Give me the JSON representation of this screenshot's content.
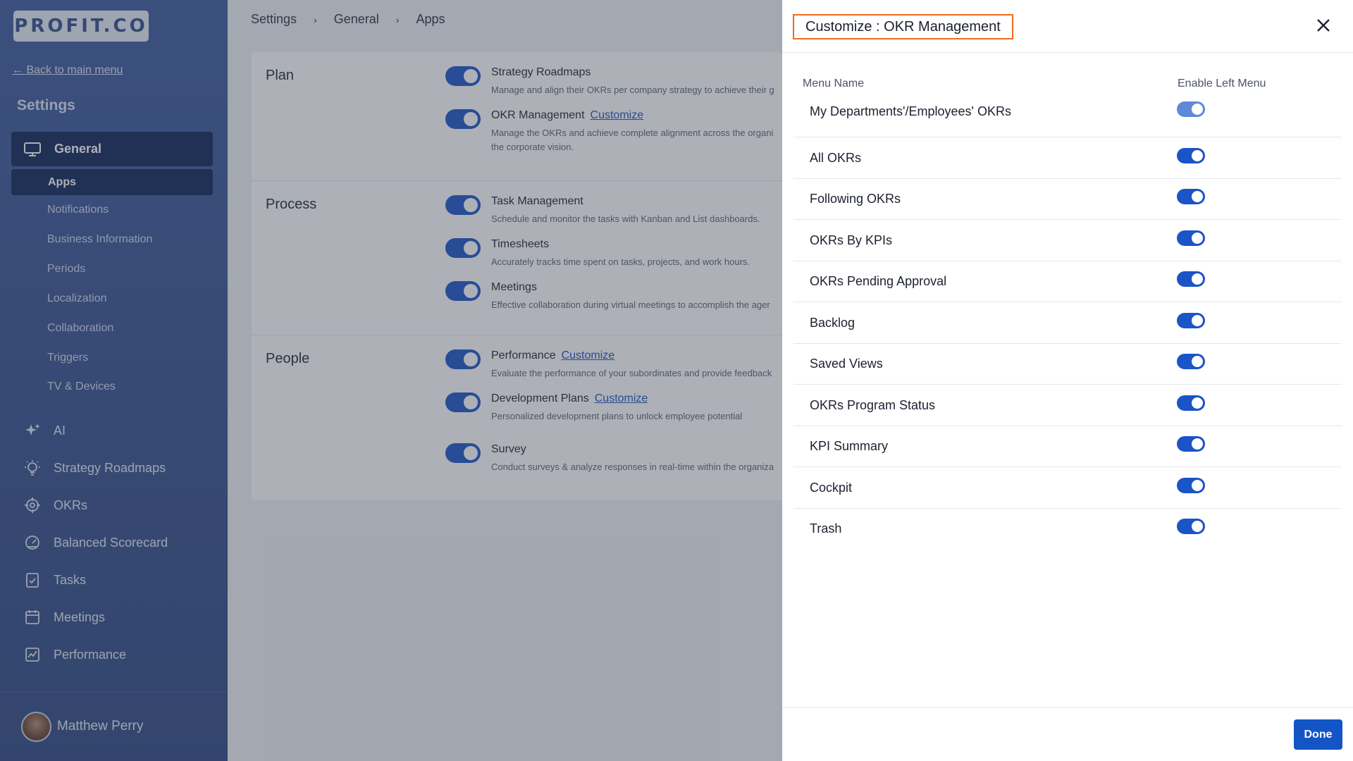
{
  "sidebar": {
    "logo_text": "PROFIT.CO",
    "back_link": "← Back to main menu",
    "title": "Settings",
    "general_label": "General",
    "apps_label": "Apps",
    "sub_items": [
      "Notifications",
      "Business Information",
      "Periods",
      "Localization",
      "Collaboration",
      "Triggers",
      "TV & Devices"
    ],
    "main_items": [
      {
        "label": "AI",
        "icon": "sparkle-icon"
      },
      {
        "label": "Strategy Roadmaps",
        "icon": "lightbulb-icon"
      },
      {
        "label": "OKRs",
        "icon": "target-icon"
      },
      {
        "label": "Balanced Scorecard",
        "icon": "gauge-icon"
      },
      {
        "label": "Tasks",
        "icon": "clipboard-check-icon"
      },
      {
        "label": "Meetings",
        "icon": "calendar-icon"
      },
      {
        "label": "Performance",
        "icon": "chart-line-icon"
      }
    ],
    "user_name": "Matthew Perry"
  },
  "breadcrumb": [
    "Settings",
    "General",
    "Apps"
  ],
  "apps": {
    "customize_label": "Customize",
    "sections": [
      {
        "title": "Plan",
        "items": [
          {
            "name": "Strategy Roadmaps",
            "desc": "Manage and align their OKRs per company strategy to achieve their g",
            "customize": false
          },
          {
            "name": "OKR Management",
            "desc": "Manage the OKRs and achieve complete alignment across the organi the corporate vision.",
            "customize": true
          }
        ]
      },
      {
        "title": "Process",
        "items": [
          {
            "name": "Task Management",
            "desc": "Schedule and monitor the tasks with Kanban and List dashboards.",
            "customize": false
          },
          {
            "name": "Timesheets",
            "desc": "Accurately tracks time spent on tasks, projects, and work hours.",
            "customize": false
          },
          {
            "name": "Meetings",
            "desc": "Effective collaboration during virtual meetings to accomplish the ager",
            "customize": false
          }
        ]
      },
      {
        "title": "People",
        "items": [
          {
            "name": "Performance",
            "desc": "Evaluate the performance of your subordinates and provide feedback",
            "customize": true
          },
          {
            "name": "Development Plans",
            "desc": "Personalized development plans to unlock employee potential",
            "customize": true
          },
          {
            "name": "Survey",
            "desc": "Conduct surveys & analyze responses in real-time within the organiza",
            "customize": false
          }
        ]
      }
    ]
  },
  "drawer": {
    "title": "Customize : OKR Management",
    "col_menu_name": "Menu Name",
    "col_enable": "Enable Left Menu",
    "rows": [
      {
        "label": "My Departments'/Employees' OKRs",
        "enabled": true,
        "disabled_style": true
      },
      {
        "label": "All OKRs",
        "enabled": true
      },
      {
        "label": "Following OKRs",
        "enabled": true
      },
      {
        "label": "OKRs By KPIs",
        "enabled": true
      },
      {
        "label": "OKRs Pending Approval",
        "enabled": true
      },
      {
        "label": "Backlog",
        "enabled": true
      },
      {
        "label": "Saved Views",
        "enabled": true
      },
      {
        "label": "OKRs Program Status",
        "enabled": true
      },
      {
        "label": "KPI Summary",
        "enabled": true
      },
      {
        "label": "Cockpit",
        "enabled": true
      },
      {
        "label": "Trash",
        "enabled": true
      }
    ],
    "done_label": "Done"
  },
  "colors": {
    "accent": "#1a54c7",
    "highlight_border": "#f06c1e",
    "sidebar_active": "#0f2458"
  }
}
